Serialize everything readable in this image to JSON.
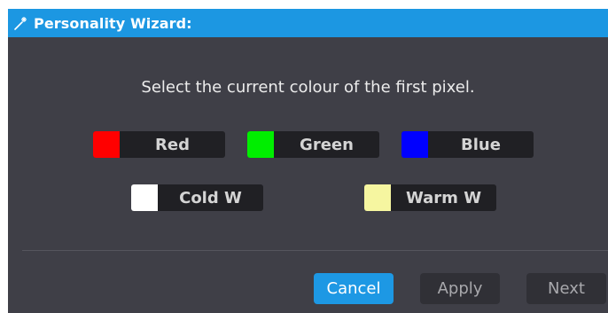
{
  "window": {
    "title": "Personality Wizard:",
    "title_icon": "magic-wand-icon"
  },
  "prompt": "Select the current colour of the first pixel.",
  "colors": [
    {
      "label": "Red",
      "swatch": "#ff0000"
    },
    {
      "label": "Green",
      "swatch": "#00ee00"
    },
    {
      "label": "Blue",
      "swatch": "#0000ff"
    },
    {
      "label": "Cold W",
      "swatch": "#ffffff"
    },
    {
      "label": "Warm W",
      "swatch": "#f6f6a0"
    }
  ],
  "footer": {
    "cancel_label": "Cancel",
    "apply_label": "Apply",
    "next_label": "Next"
  },
  "theme": {
    "accent": "#1c97e2",
    "background": "#3f3f47"
  }
}
